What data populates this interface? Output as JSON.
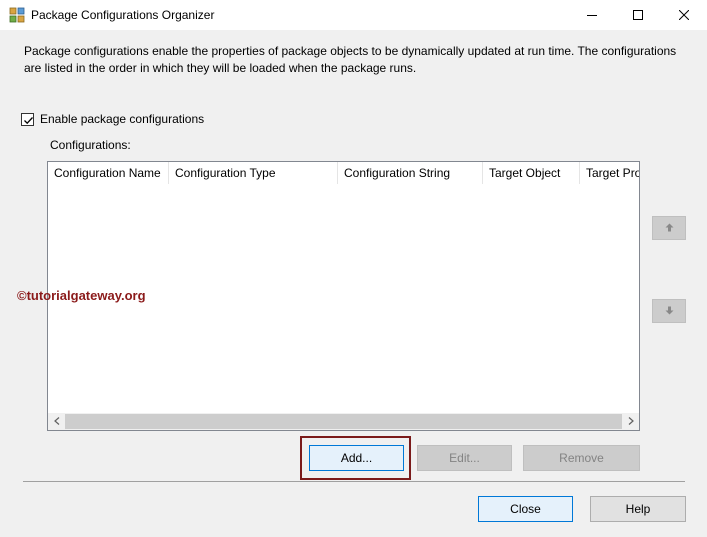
{
  "window": {
    "title": "Package Configurations Organizer",
    "minimize_icon": "minimize-icon",
    "maximize_icon": "maximize-icon",
    "close_icon": "close-icon"
  },
  "description": "Package configurations enable the properties of package objects to be dynamically updated at run time. The configurations are listed in the order in which they will be loaded when the package runs.",
  "enable_checkbox": {
    "label": "Enable package configurations",
    "checked": true
  },
  "configurations": {
    "label": "Configurations:",
    "columns": [
      "Configuration Name",
      "Configuration Type",
      "Configuration String",
      "Target Object",
      "Target Pro"
    ],
    "rows": []
  },
  "side_buttons": {
    "up_icon": "arrow-up-icon",
    "down_icon": "arrow-down-icon"
  },
  "buttons": {
    "add": "Add...",
    "edit": "Edit...",
    "remove": "Remove",
    "close": "Close",
    "help": "Help"
  },
  "watermark": "©tutorialgateway.org",
  "colors": {
    "accent": "#0078d7",
    "highlight": "#7b1a1a",
    "watermark": "#8b1a1a"
  }
}
